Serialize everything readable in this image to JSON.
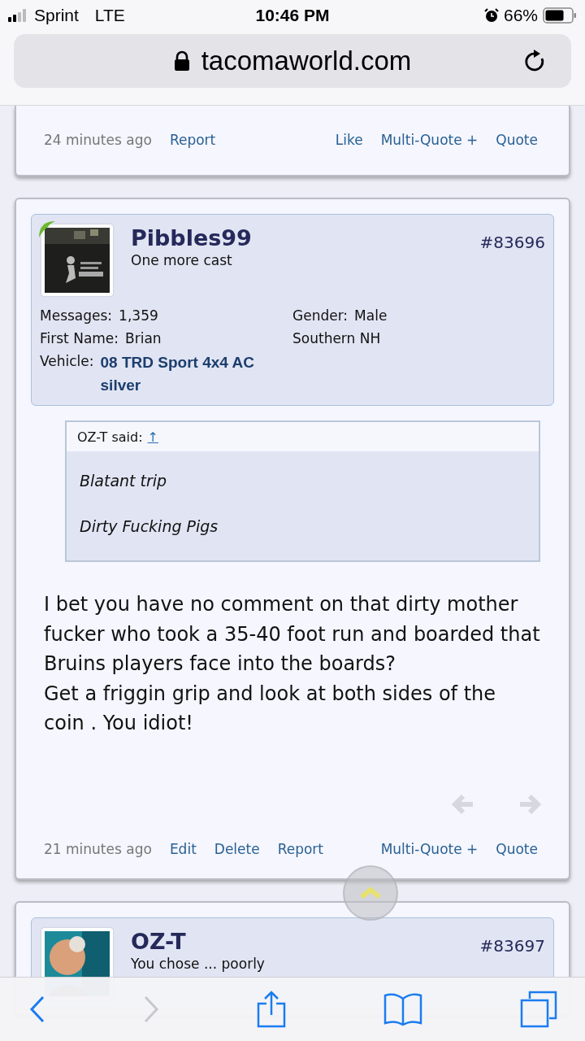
{
  "status_bar": {
    "carrier": "Sprint",
    "network": "LTE",
    "time": "10:46 PM",
    "battery": "66%"
  },
  "browser": {
    "url": "tacomaworld.com"
  },
  "posts": [
    {
      "kind": "tail",
      "time": "24 minutes ago",
      "actions_left": [
        "Report"
      ],
      "actions_right": [
        "Like",
        "Multi-Quote +",
        "Quote"
      ]
    },
    {
      "kind": "full",
      "user": {
        "name": "Pibbles99",
        "title": "One more cast",
        "number": "#83696",
        "online": true,
        "stats_left": [
          {
            "label": "Messages:",
            "value": "1,359",
            "link": false
          },
          {
            "label": "First Name:",
            "value": "Brian",
            "link": false
          },
          {
            "label": "Vehicle:",
            "value": "08 TRD Sport 4x4 AC silver",
            "link": true
          }
        ],
        "stats_right": [
          {
            "label": "Gender:",
            "value": "Male",
            "link": false
          },
          {
            "value": "Southern NH",
            "link": false
          }
        ]
      },
      "quote": {
        "author": "OZ-T said:",
        "jump": "↑",
        "lines": [
          "Blatant trip",
          "Dirty Fucking Pigs"
        ]
      },
      "message": [
        "I bet you have no comment on that dirty mother fucker who took a 35-40 foot run and boarded that Bruins players face into the boards?",
        "Get a friggin grip and look at both sides of the coin . You idiot!"
      ],
      "time": "21 minutes ago",
      "actions_left": [
        "Edit",
        "Delete",
        "Report"
      ],
      "actions_right": [
        "Multi-Quote +",
        "Quote"
      ]
    },
    {
      "kind": "head",
      "user": {
        "name": "OZ-T",
        "title": "You chose ... poorly",
        "number": "#83697",
        "online": false
      }
    }
  ]
}
